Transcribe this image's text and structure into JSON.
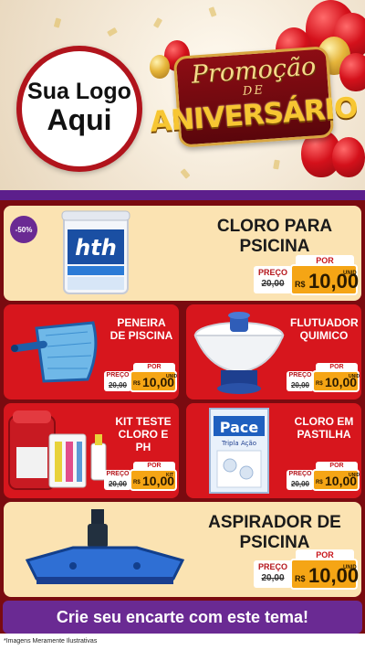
{
  "header": {
    "logo_line1": "Sua Logo",
    "logo_line2": "Aqui",
    "promo_line1": "Promoção",
    "promo_line2": "DE",
    "promo_line3": "ANIVERSÁRIO"
  },
  "products": [
    {
      "name": "CLORO PARA PSICINA",
      "badge": "-50%",
      "por": "POR",
      "preco": "PREÇO",
      "old": "20,00",
      "currency": "R$",
      "price": "10,00",
      "unit": "UNID"
    },
    {
      "name": "PENEIRA DE PISCINA",
      "por": "POR",
      "preco": "PREÇO",
      "old": "20,00",
      "currency": "R$",
      "price": "10,00",
      "unit": "UNID"
    },
    {
      "name": "FLUTUADOR QUIMICO",
      "por": "POR",
      "preco": "PREÇO",
      "old": "20,00",
      "currency": "R$",
      "price": "10,00",
      "unit": "UNID"
    },
    {
      "name": "KIT TESTE CLORO E PH",
      "por": "POR",
      "preco": "PREÇO",
      "old": "20,00",
      "currency": "R$",
      "price": "10,00",
      "unit": "KIT"
    },
    {
      "name": "CLORO EM PASTILHA",
      "por": "POR",
      "preco": "PREÇO",
      "old": "20,00",
      "currency": "R$",
      "price": "10,00",
      "unit": "UNID"
    },
    {
      "name": "ASPIRADOR DE PSICINA",
      "por": "POR",
      "preco": "PREÇO",
      "old": "20,00",
      "currency": "R$",
      "price": "10,00",
      "unit": "UNID"
    }
  ],
  "product_labels": {
    "bucket_brand": "hth",
    "pace_brand": "Pace",
    "pace_sub": "Tripla Ação"
  },
  "cta": "Crie seu encarte com este tema!",
  "footer": "*Imagens Meramente Ilustrativas",
  "colors": {
    "accent_purple": "#6a2a93",
    "brand_red": "#d7161d",
    "cream": "#fbe3b2",
    "price_orange": "#f5a515"
  }
}
